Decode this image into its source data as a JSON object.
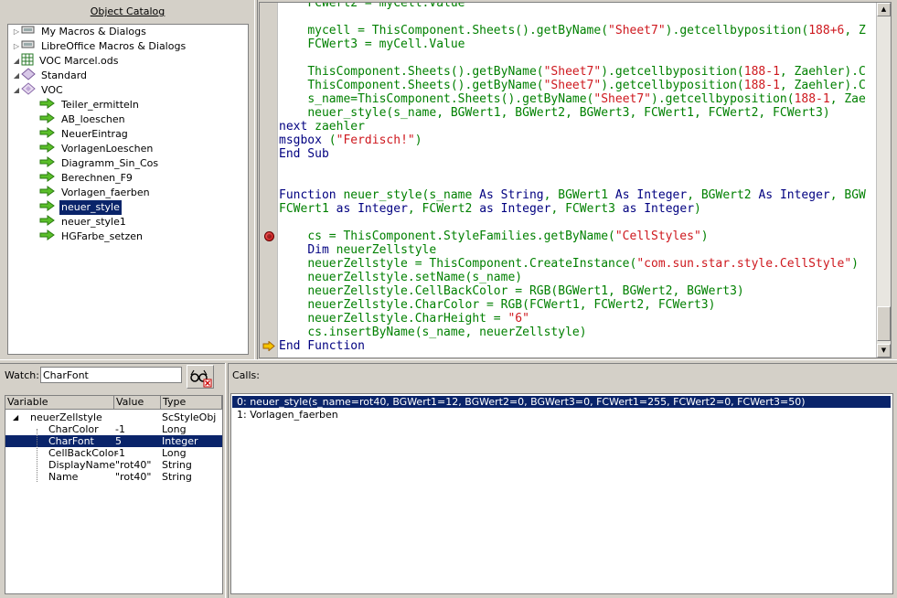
{
  "catalog": {
    "title": "Object Catalog",
    "items": [
      {
        "label": "My Macros & Dialogs",
        "level": 0,
        "expander": "▷",
        "icon": "computer-icon"
      },
      {
        "label": "LibreOffice Macros & Dialogs",
        "level": 0,
        "expander": "▷",
        "icon": "computer-icon"
      },
      {
        "label": "VOC Marcel.ods",
        "level": 0,
        "expander": "◢",
        "icon": "spreadsheet-icon"
      },
      {
        "label": "Standard",
        "level": 1,
        "expander": "◢",
        "icon": "library-icon"
      },
      {
        "label": "VOC",
        "level": 2,
        "expander": "◢",
        "icon": "module-icon"
      },
      {
        "label": "Teiler_ermitteln",
        "level": 3,
        "icon": "macro-icon"
      },
      {
        "label": "AB_loeschen",
        "level": 3,
        "icon": "macro-icon"
      },
      {
        "label": "NeuerEintrag",
        "level": 3,
        "icon": "macro-icon"
      },
      {
        "label": "VorlagenLoeschen",
        "level": 3,
        "icon": "macro-icon"
      },
      {
        "label": "Diagramm_Sin_Cos",
        "level": 3,
        "icon": "macro-icon"
      },
      {
        "label": "Berechnen_F9",
        "level": 3,
        "icon": "macro-icon"
      },
      {
        "label": "Vorlagen_faerben",
        "level": 3,
        "icon": "macro-icon"
      },
      {
        "label": "neuer_style",
        "level": 3,
        "icon": "macro-icon",
        "selected": true
      },
      {
        "label": "neuer_style1",
        "level": 3,
        "icon": "macro-icon"
      },
      {
        "label": "HGFarbe_setzen",
        "level": 3,
        "icon": "macro-icon"
      }
    ]
  },
  "editor": {
    "lines": [
      [
        {
          "t": "    ",
          "c": ""
        },
        {
          "t": "FCWert2 = myCell.Value",
          "c": "id"
        }
      ],
      [
        {
          "t": "",
          "c": ""
        }
      ],
      [
        {
          "t": "    ",
          "c": ""
        },
        {
          "t": "mycell = ThisComponent.Sheets().getByName(",
          "c": "id"
        },
        {
          "t": "\"Sheet7\"",
          "c": "st"
        },
        {
          "t": ").getcellbyposition(",
          "c": "id"
        },
        {
          "t": "188+6",
          "c": "st"
        },
        {
          "t": ", Z",
          "c": "id"
        }
      ],
      [
        {
          "t": "    ",
          "c": ""
        },
        {
          "t": "FCWert3 = myCell.Value",
          "c": "id"
        }
      ],
      [
        {
          "t": "",
          "c": ""
        }
      ],
      [
        {
          "t": "    ",
          "c": ""
        },
        {
          "t": "ThisComponent.Sheets().getByName(",
          "c": "id"
        },
        {
          "t": "\"Sheet7\"",
          "c": "st"
        },
        {
          "t": ").getcellbyposition(",
          "c": "id"
        },
        {
          "t": "188-1",
          "c": "st"
        },
        {
          "t": ", Zaehler).C",
          "c": "id"
        }
      ],
      [
        {
          "t": "    ",
          "c": ""
        },
        {
          "t": "ThisComponent.Sheets().getByName(",
          "c": "id"
        },
        {
          "t": "\"Sheet7\"",
          "c": "st"
        },
        {
          "t": ").getcellbyposition(",
          "c": "id"
        },
        {
          "t": "188-1",
          "c": "st"
        },
        {
          "t": ", Zaehler).C",
          "c": "id"
        }
      ],
      [
        {
          "t": "    ",
          "c": ""
        },
        {
          "t": "s_name=ThisComponent.Sheets().getByName(",
          "c": "id"
        },
        {
          "t": "\"Sheet7\"",
          "c": "st"
        },
        {
          "t": ").getcellbyposition(",
          "c": "id"
        },
        {
          "t": "188-1",
          "c": "st"
        },
        {
          "t": ", Zae",
          "c": "id"
        }
      ],
      [
        {
          "t": "    ",
          "c": ""
        },
        {
          "t": "neuer_style(s_name, BGWert1, BGWert2, BGWert3, FCWert1, FCWert2, FCWert3)",
          "c": "id"
        }
      ],
      [
        {
          "t": "next ",
          "c": "kw"
        },
        {
          "t": "zaehler",
          "c": "id"
        }
      ],
      [
        {
          "t": "msgbox ",
          "c": "kw"
        },
        {
          "t": "(",
          "c": "id"
        },
        {
          "t": "\"Ferdisch!\"",
          "c": "st"
        },
        {
          "t": ")",
          "c": "id"
        }
      ],
      [
        {
          "t": "End Sub",
          "c": "kw"
        }
      ],
      [
        {
          "t": "",
          "c": ""
        }
      ],
      [
        {
          "t": "",
          "c": ""
        }
      ],
      [
        {
          "t": "Function ",
          "c": "kw"
        },
        {
          "t": "neuer_style(s_name ",
          "c": "id"
        },
        {
          "t": "As String",
          "c": "kw"
        },
        {
          "t": ", BGWert1 ",
          "c": "id"
        },
        {
          "t": "As Integer",
          "c": "kw"
        },
        {
          "t": ", BGWert2 ",
          "c": "id"
        },
        {
          "t": "As Integer",
          "c": "kw"
        },
        {
          "t": ", BGW",
          "c": "id"
        }
      ],
      [
        {
          "t": "FCWert1 ",
          "c": "id"
        },
        {
          "t": "as Integer",
          "c": "kw"
        },
        {
          "t": ", FCWert2 ",
          "c": "id"
        },
        {
          "t": "as Integer",
          "c": "kw"
        },
        {
          "t": ", FCWert3 ",
          "c": "id"
        },
        {
          "t": "as Integer",
          "c": "kw"
        },
        {
          "t": ")",
          "c": "id"
        }
      ],
      [
        {
          "t": "",
          "c": ""
        }
      ],
      [
        {
          "t": "    ",
          "c": ""
        },
        {
          "t": "cs = ThisComponent.StyleFamilies.getByName(",
          "c": "id"
        },
        {
          "t": "\"CellStyles\"",
          "c": "st"
        },
        {
          "t": ")",
          "c": "id"
        }
      ],
      [
        {
          "t": "    ",
          "c": ""
        },
        {
          "t": "Dim ",
          "c": "kw"
        },
        {
          "t": "neuerZellstyle",
          "c": "id"
        }
      ],
      [
        {
          "t": "    ",
          "c": ""
        },
        {
          "t": "neuerZellstyle = ThisComponent.CreateInstance(",
          "c": "id"
        },
        {
          "t": "\"com.sun.star.style.CellStyle\"",
          "c": "st"
        },
        {
          "t": ")",
          "c": "id"
        }
      ],
      [
        {
          "t": "    ",
          "c": ""
        },
        {
          "t": "neuerZellstyle.setName(s_name)",
          "c": "id"
        }
      ],
      [
        {
          "t": "    ",
          "c": ""
        },
        {
          "t": "neuerZellstyle.CellBackColor = RGB(BGWert1, BGWert2, BGWert3)",
          "c": "id"
        }
      ],
      [
        {
          "t": "    ",
          "c": ""
        },
        {
          "t": "neuerZellstyle.CharColor = RGB(FCWert1, FCWert2, FCWert3)",
          "c": "id"
        }
      ],
      [
        {
          "t": "    ",
          "c": ""
        },
        {
          "t": "neuerZellstyle.CharHeight = ",
          "c": "id"
        },
        {
          "t": "\"6\"",
          "c": "st"
        }
      ],
      [
        {
          "t": "    ",
          "c": ""
        },
        {
          "t": "cs.insertByName(s_name, neuerZellstyle)",
          "c": "id"
        }
      ],
      [
        {
          "t": "End Function",
          "c": "kw"
        }
      ]
    ],
    "breakpoint_line": 17,
    "current_line": 25,
    "scroll_up": "▲",
    "scroll_down": "▼"
  },
  "watch": {
    "label": "Watch:",
    "input_value": "CharFont",
    "columns": [
      "Variable",
      "Value",
      "Type"
    ],
    "rows": [
      {
        "name": "neuerZellstyle",
        "value": "",
        "type": "ScStyleObj",
        "level": 0,
        "expander": "◢"
      },
      {
        "name": "CharColor",
        "value": "-1",
        "type": "Long",
        "level": 1
      },
      {
        "name": "CharFont",
        "value": "5",
        "type": "Integer",
        "level": 1,
        "selected": true
      },
      {
        "name": "CellBackColor",
        "value": "-1",
        "type": "Long",
        "level": 1
      },
      {
        "name": "DisplayName",
        "value": "\"rot40\"",
        "type": "String",
        "level": 1
      },
      {
        "name": "Name",
        "value": "\"rot40\"",
        "type": "String",
        "level": 1
      }
    ]
  },
  "calls": {
    "label": "Calls:",
    "items": [
      {
        "text": "0: neuer_style(s_name=rot40, BGWert1=12, BGWert2=0, BGWert3=0, FCWert1=255, FCWert2=0, FCWert3=50)",
        "selected": true
      },
      {
        "text": "1: Vorlagen_faerben",
        "selected": false
      }
    ]
  },
  "colors": {
    "selection": "#0a246a",
    "keyword": "#000080",
    "identifier": "#008000",
    "string": "#ce181e"
  }
}
